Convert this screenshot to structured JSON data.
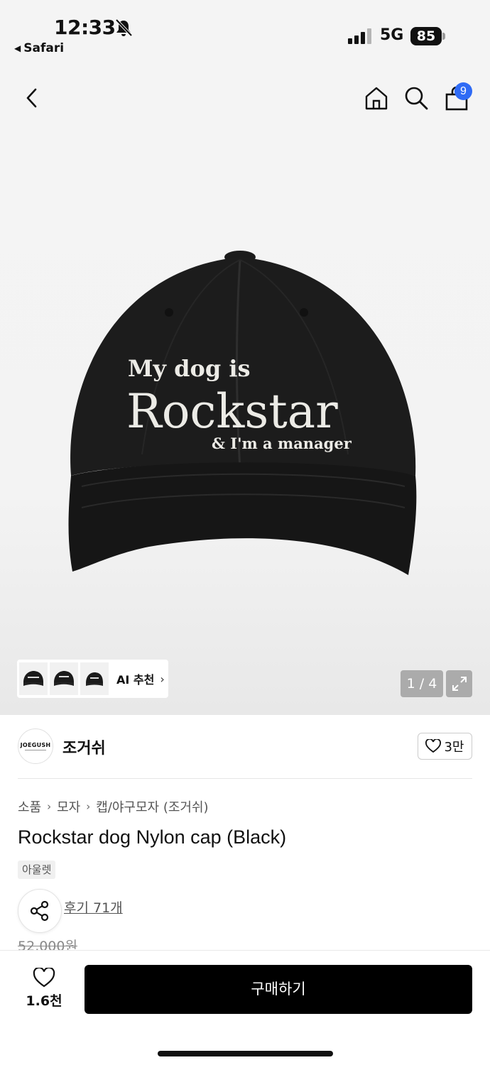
{
  "status_bar": {
    "time": "12:33",
    "back_app": "Safari",
    "network": "5G",
    "battery": "85"
  },
  "nav": {
    "cart_count": "9"
  },
  "gallery": {
    "cap_text_line1": "My dog is",
    "cap_text_line2": "Rockstar",
    "cap_text_line3": "& I'm a manager",
    "ai_recommend_label": "AI 추천",
    "page_counter": "1 / 4"
  },
  "brand": {
    "logo_text": "JOEGUSH",
    "name": "조거쉬",
    "like_count": "3만"
  },
  "breadcrumb": [
    "소품",
    "모자",
    "캡/야구모자 (조거쉬)"
  ],
  "product": {
    "title": "Rockstar dog Nylon cap (Black)",
    "tag": "아울렛",
    "review_link": "후기 71개",
    "original_price": "52,000원"
  },
  "bottom_bar": {
    "wish_count": "1.6천",
    "buy_label": "구매하기"
  },
  "colors": {
    "badge": "#2f6bf5",
    "buy_button": "#000000"
  }
}
